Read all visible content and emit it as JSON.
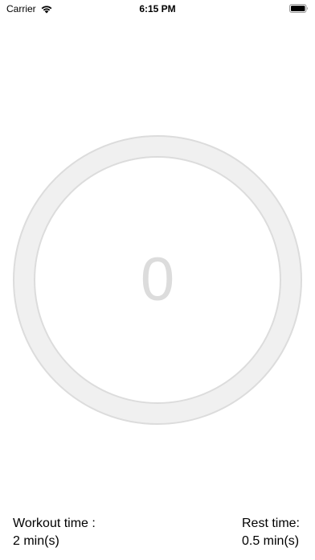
{
  "status_bar": {
    "carrier": "Carrier",
    "time": "6:15 PM",
    "icons": [
      "wifi-icon",
      "battery-icon"
    ]
  },
  "timer": {
    "count": "0",
    "ring_color": "#f0f0f0",
    "ring_border_color": "#dcdcdc",
    "count_color": "#dcdcdc"
  },
  "workout": {
    "label": "Workout time :",
    "value": "2 min(s)"
  },
  "rest": {
    "label": "Rest time:",
    "value": "0.5 min(s)"
  }
}
